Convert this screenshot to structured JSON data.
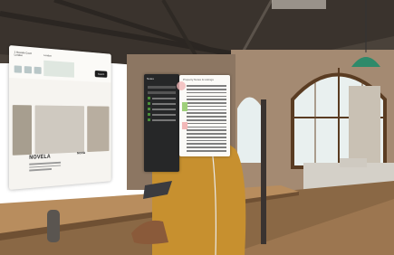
{
  "scene": {
    "description_free": true
  },
  "listing_window": {
    "address_label": "1 Hounds Court London",
    "location_label": "London",
    "search_button_label": "Search",
    "listing_name": "NOVELA",
    "second_listing_name": "NOVA"
  },
  "notes_panel": {
    "title": "Notes"
  },
  "document_panel": {
    "header": "Property Notes & Listings"
  },
  "colors": {
    "accent_green": "#4a8f3a",
    "highlight_green": "#9fd07b",
    "highlight_pink": "#f2b8b8",
    "sweater": "#c7902f"
  }
}
